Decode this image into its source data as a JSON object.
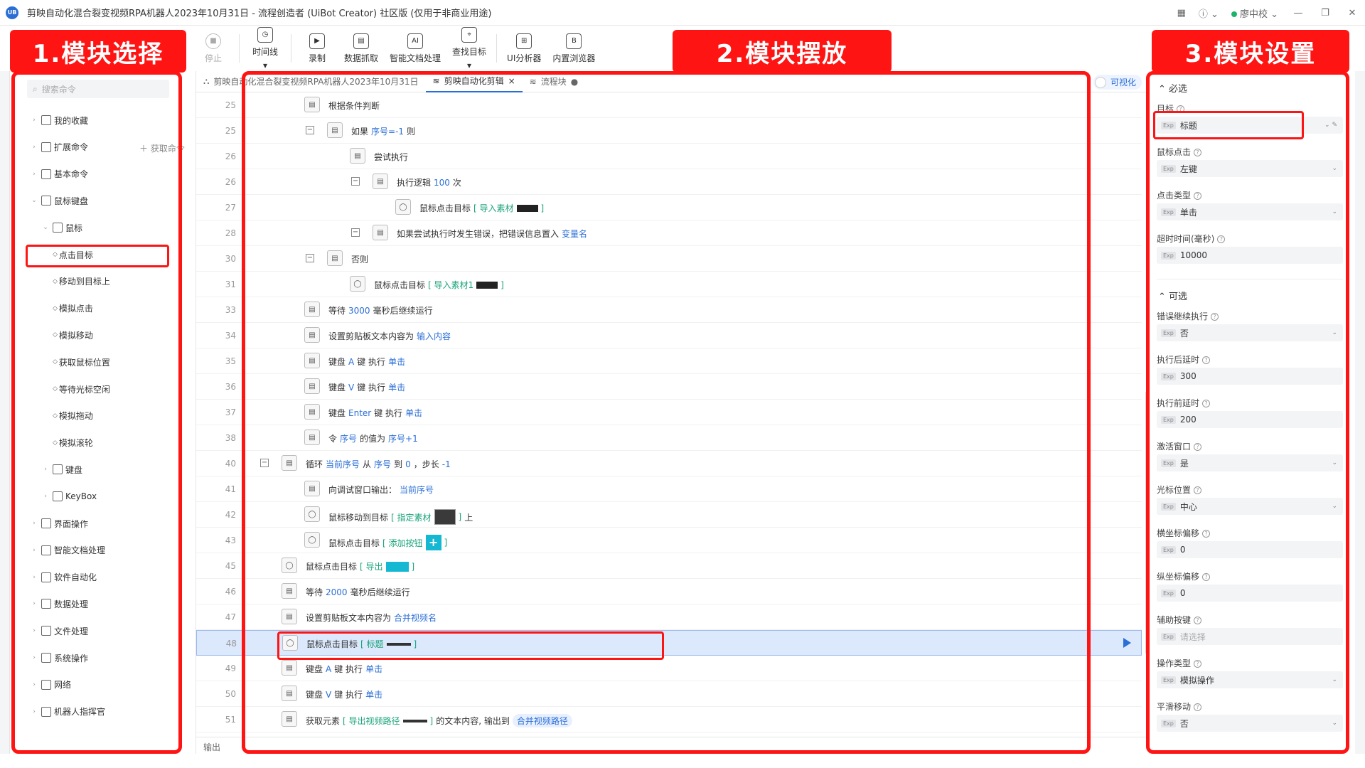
{
  "app": {
    "title": "剪映自动化混合裂变视频RPA机器人2023年10月31日 - 流程创造者 (UiBot Creator) 社区版 (仅用于非商业用途)",
    "logo_text": "UB",
    "user": "廖中校"
  },
  "toolbar": [
    {
      "label": "停止",
      "icon": "stop-icon",
      "disabled": true
    },
    {
      "label": "时间线",
      "icon": "clock-icon",
      "dropdown": true
    },
    {
      "label": "录制",
      "icon": "record-icon"
    },
    {
      "label": "数据抓取",
      "icon": "data-scrape-icon"
    },
    {
      "label": "智能文档处理",
      "icon": "ai-doc-icon"
    },
    {
      "label": "查找目标",
      "icon": "find-target-icon",
      "dropdown": true
    },
    {
      "label": "UI分析器",
      "icon": "ui-analyzer-icon"
    },
    {
      "label": "内置浏览器",
      "icon": "browser-icon"
    }
  ],
  "sidebar": {
    "search_placeholder": "搜索命令",
    "get_command": "获取命令",
    "items": [
      {
        "label": "我的收藏",
        "level": 0,
        "arrow": "›"
      },
      {
        "label": "扩展命令",
        "level": 0,
        "arrow": "›"
      },
      {
        "label": "基本命令",
        "level": 0,
        "arrow": "›"
      },
      {
        "label": "鼠标键盘",
        "level": 0,
        "arrow": "⌄"
      },
      {
        "label": "鼠标",
        "level": 1,
        "arrow": "⌄"
      },
      {
        "label": "点击目标",
        "level": 2,
        "bullet": true
      },
      {
        "label": "移动到目标上",
        "level": 2,
        "bullet": true
      },
      {
        "label": "模拟点击",
        "level": 2,
        "bullet": true
      },
      {
        "label": "模拟移动",
        "level": 2,
        "bullet": true
      },
      {
        "label": "获取鼠标位置",
        "level": 2,
        "bullet": true
      },
      {
        "label": "等待光标空闲",
        "level": 2,
        "bullet": true
      },
      {
        "label": "模拟拖动",
        "level": 2,
        "bullet": true
      },
      {
        "label": "模拟滚轮",
        "level": 2,
        "bullet": true
      },
      {
        "label": "键盘",
        "level": 1,
        "arrow": "›"
      },
      {
        "label": "KeyBox",
        "level": 1,
        "arrow": "›"
      },
      {
        "label": "界面操作",
        "level": 0,
        "arrow": "›"
      },
      {
        "label": "智能文档处理",
        "level": 0,
        "arrow": "›"
      },
      {
        "label": "软件自动化",
        "level": 0,
        "arrow": "›"
      },
      {
        "label": "数据处理",
        "level": 0,
        "arrow": "›"
      },
      {
        "label": "文件处理",
        "level": 0,
        "arrow": "›"
      },
      {
        "label": "系统操作",
        "level": 0,
        "arrow": "›"
      },
      {
        "label": "网络",
        "level": 0,
        "arrow": "›"
      },
      {
        "label": "机器人指挥官",
        "level": 0,
        "arrow": "›"
      }
    ]
  },
  "tabs": [
    {
      "label": "剪映自动化混合裂变视频RPA机器人2023年10月31日",
      "active": false
    },
    {
      "label": "剪映自动化剪辑",
      "active": true,
      "closable": true
    },
    {
      "label": "流程块",
      "active": false,
      "dot": true
    }
  ],
  "visualize_label": "可视化",
  "output_label": "输出",
  "lines": [
    {
      "n": "25",
      "indent": 1,
      "text": [
        [
          "t",
          "根据条件判断"
        ]
      ]
    },
    {
      "n": "25",
      "indent": 2,
      "collapse": true,
      "text": [
        [
          "t",
          "如果 "
        ],
        [
          "v",
          "序号=-1"
        ],
        [
          "t",
          " 则"
        ]
      ]
    },
    {
      "n": "26",
      "indent": 3,
      "text": [
        [
          "t",
          "尝试执行"
        ]
      ]
    },
    {
      "n": "26",
      "indent": 4,
      "collapse": true,
      "text": [
        [
          "t",
          "执行逻辑 "
        ],
        [
          "v",
          "100"
        ],
        [
          "t",
          " 次"
        ]
      ]
    },
    {
      "n": "27",
      "indent": 5,
      "mouse": true,
      "text": [
        [
          "t",
          "鼠标点击目标 "
        ],
        [
          "k",
          "[ 导入素材 "
        ],
        [
          "img",
          "thumb"
        ],
        [
          "k",
          " ]"
        ]
      ]
    },
    {
      "n": "28",
      "indent": 4,
      "collapse": true,
      "text": [
        [
          "t",
          "如果尝试执行时发生错误，把错误信息置入 "
        ],
        [
          "v",
          "变量名"
        ]
      ]
    },
    {
      "n": "30",
      "indent": 2,
      "collapse": true,
      "text": [
        [
          "t",
          "否则"
        ]
      ]
    },
    {
      "n": "31",
      "indent": 3,
      "mouse": true,
      "text": [
        [
          "t",
          "鼠标点击目标 "
        ],
        [
          "k",
          "[ 导入素材1 "
        ],
        [
          "img",
          "thumb"
        ],
        [
          "k",
          " ]"
        ]
      ]
    },
    {
      "n": "33",
      "indent": 1,
      "text": [
        [
          "t",
          "等待 "
        ],
        [
          "v",
          "3000"
        ],
        [
          "t",
          " 毫秒后继续运行"
        ]
      ]
    },
    {
      "n": "34",
      "indent": 1,
      "text": [
        [
          "t",
          "设置剪贴板文本内容为 "
        ],
        [
          "v",
          "输入内容"
        ]
      ]
    },
    {
      "n": "35",
      "indent": 1,
      "text": [
        [
          "t",
          "键盘 "
        ],
        [
          "v",
          "A"
        ],
        [
          "t",
          " 键 执行 "
        ],
        [
          "v",
          "单击"
        ]
      ]
    },
    {
      "n": "36",
      "indent": 1,
      "text": [
        [
          "t",
          "键盘 "
        ],
        [
          "v",
          "V"
        ],
        [
          "t",
          " 键 执行 "
        ],
        [
          "v",
          "单击"
        ]
      ]
    },
    {
      "n": "37",
      "indent": 1,
      "text": [
        [
          "t",
          "键盘 "
        ],
        [
          "v",
          "Enter"
        ],
        [
          "t",
          " 键 执行 "
        ],
        [
          "v",
          "单击"
        ]
      ]
    },
    {
      "n": "38",
      "indent": 1,
      "text": [
        [
          "t",
          "令 "
        ],
        [
          "v",
          "序号"
        ],
        [
          "t",
          " 的值为 "
        ],
        [
          "v",
          "序号+1"
        ]
      ]
    },
    {
      "n": "40",
      "indent": 0,
      "collapse": true,
      "text": [
        [
          "t",
          "循环 "
        ],
        [
          "v",
          "当前序号"
        ],
        [
          "t",
          " 从 "
        ],
        [
          "v",
          "序号"
        ],
        [
          "t",
          " 到 "
        ],
        [
          "v",
          "0"
        ],
        [
          "t",
          " ，步长 "
        ],
        [
          "v",
          "-1"
        ]
      ]
    },
    {
      "n": "41",
      "indent": 1,
      "text": [
        [
          "t",
          "向调试窗口输出： "
        ],
        [
          "v",
          "当前序号"
        ]
      ]
    },
    {
      "n": "42",
      "indent": 1,
      "mouse": true,
      "text": [
        [
          "t",
          "鼠标移动到目标 "
        ],
        [
          "k",
          "[ 指定素材 "
        ],
        [
          "img",
          "thumb-lg"
        ],
        [
          "k",
          " ]"
        ],
        [
          "t",
          " 上"
        ]
      ]
    },
    {
      "n": "43",
      "indent": 1,
      "mouse": true,
      "text": [
        [
          "t",
          "鼠标点击目标 "
        ],
        [
          "k",
          "[ 添加按钮 "
        ],
        [
          "img",
          "thumb-plus"
        ],
        [
          "k",
          " ]"
        ]
      ]
    },
    {
      "n": "45",
      "indent": 0,
      "mouse": true,
      "text": [
        [
          "t",
          "鼠标点击目标 "
        ],
        [
          "k",
          "[ 导出 "
        ],
        [
          "img",
          "thumb-btn"
        ],
        [
          "k",
          " ]"
        ]
      ]
    },
    {
      "n": "46",
      "indent": 0,
      "text": [
        [
          "t",
          "等待 "
        ],
        [
          "v",
          "2000"
        ],
        [
          "t",
          " 毫秒后继续运行"
        ]
      ]
    },
    {
      "n": "47",
      "indent": 0,
      "text": [
        [
          "t",
          "设置剪贴板文本内容为 "
        ],
        [
          "v",
          "合并视频名"
        ]
      ]
    },
    {
      "n": "48",
      "indent": 0,
      "mouse": true,
      "selected": true,
      "text": [
        [
          "t",
          "鼠标点击目标 "
        ],
        [
          "k",
          "[ 标题 "
        ],
        [
          "img",
          "thumb-bar"
        ],
        [
          "k",
          " ]"
        ]
      ]
    },
    {
      "n": "49",
      "indent": 0,
      "text": [
        [
          "t",
          "键盘 "
        ],
        [
          "v",
          "A"
        ],
        [
          "t",
          " 键 执行 "
        ],
        [
          "v",
          "单击"
        ]
      ]
    },
    {
      "n": "50",
      "indent": 0,
      "text": [
        [
          "t",
          "键盘 "
        ],
        [
          "v",
          "V"
        ],
        [
          "t",
          " 键 执行 "
        ],
        [
          "v",
          "单击"
        ]
      ]
    },
    {
      "n": "51",
      "indent": 0,
      "text": [
        [
          "t",
          "获取元素 "
        ],
        [
          "k",
          "[ 导出视频路径 "
        ],
        [
          "img",
          "thumb-bar"
        ],
        [
          "k",
          " ]"
        ],
        [
          "t",
          " 的文本内容, 输出到 "
        ],
        [
          "p",
          "合并视频路径"
        ]
      ]
    }
  ],
  "props": {
    "required_title": "必选",
    "optional_title": "可选",
    "required": [
      {
        "label": "目标",
        "value": "标题",
        "edit": true
      },
      {
        "label": "鼠标点击",
        "value": "左键",
        "select": true
      },
      {
        "label": "点击类型",
        "value": "单击",
        "select": true
      },
      {
        "label": "超时时间(毫秒)",
        "value": "10000"
      }
    ],
    "optional": [
      {
        "label": "错误继续执行",
        "value": "否",
        "select": true
      },
      {
        "label": "执行后延时",
        "value": "300"
      },
      {
        "label": "执行前延时",
        "value": "200"
      },
      {
        "label": "激活窗口",
        "value": "是",
        "select": true
      },
      {
        "label": "光标位置",
        "value": "中心",
        "select": true
      },
      {
        "label": "横坐标偏移",
        "value": "0"
      },
      {
        "label": "纵坐标偏移",
        "value": "0"
      },
      {
        "label": "辅助按键",
        "value": "",
        "placeholder": "请选择"
      },
      {
        "label": "操作类型",
        "value": "模拟操作",
        "select": true
      },
      {
        "label": "平滑移动",
        "value": "否",
        "select": true
      }
    ]
  },
  "annotations": {
    "block_select": "1.模块选择",
    "block_place": "2.模块摆放",
    "block_settings": "3.模块设置"
  },
  "colors": {
    "accent": "#2b6fd6",
    "annotation_red": "#ff1414",
    "keyword_green": "#1aa37a"
  }
}
